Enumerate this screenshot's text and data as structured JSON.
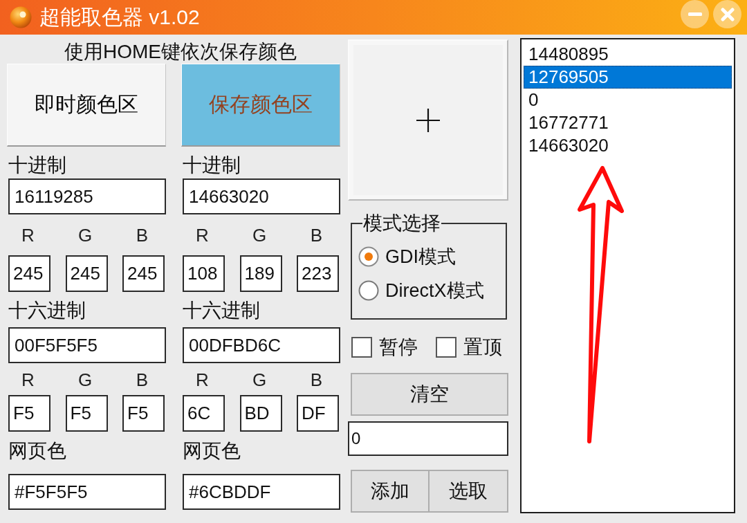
{
  "window": {
    "title": "超能取色器 v1.02"
  },
  "hint": "使用HOME键依次保存颜色",
  "panels": [
    {
      "label": "即时颜色区",
      "color": "#f5f5f5",
      "decimal_label": "十进制",
      "decimal": "16119285",
      "rgb": [
        {
          "label": "R",
          "value": "245"
        },
        {
          "label": "G",
          "value": "245"
        },
        {
          "label": "B",
          "value": "245"
        }
      ],
      "hex_label": "十六进制",
      "hex": "00F5F5F5",
      "hex_rgb": [
        {
          "label": "R",
          "value": "F5"
        },
        {
          "label": "G",
          "value": "F5"
        },
        {
          "label": "B",
          "value": "F5"
        }
      ],
      "web_label": "网页色",
      "web": "#F5F5F5"
    },
    {
      "label": "保存颜色区",
      "color": "#6cbddf",
      "decimal_label": "十进制",
      "decimal": "14663020",
      "rgb": [
        {
          "label": "R",
          "value": "108"
        },
        {
          "label": "G",
          "value": "189"
        },
        {
          "label": "B",
          "value": "223"
        }
      ],
      "hex_label": "十六进制",
      "hex": "00DFBD6C",
      "hex_rgb": [
        {
          "label": "R",
          "value": "6C"
        },
        {
          "label": "G",
          "value": "BD"
        },
        {
          "label": "B",
          "value": "DF"
        }
      ],
      "web_label": "网页色",
      "web": "#6CBDDF"
    }
  ],
  "mode_group": {
    "title": "模式选择",
    "options": [
      {
        "label": "GDI模式",
        "selected": true
      },
      {
        "label": "DirectX模式",
        "selected": false
      }
    ]
  },
  "checkboxes": [
    {
      "label": "暂停",
      "checked": false
    },
    {
      "label": "置顶",
      "checked": false
    }
  ],
  "clear_button": {
    "label": "清空"
  },
  "count_field": {
    "value": "0"
  },
  "buttons": [
    {
      "label": "添加"
    },
    {
      "label": "选取"
    }
  ],
  "list": {
    "items": [
      {
        "text": "14480895",
        "selected": false
      },
      {
        "text": "12769505",
        "selected": true
      },
      {
        "text": "0",
        "selected": false
      },
      {
        "text": "16772771",
        "selected": false
      },
      {
        "text": "14663020",
        "selected": false
      }
    ]
  }
}
